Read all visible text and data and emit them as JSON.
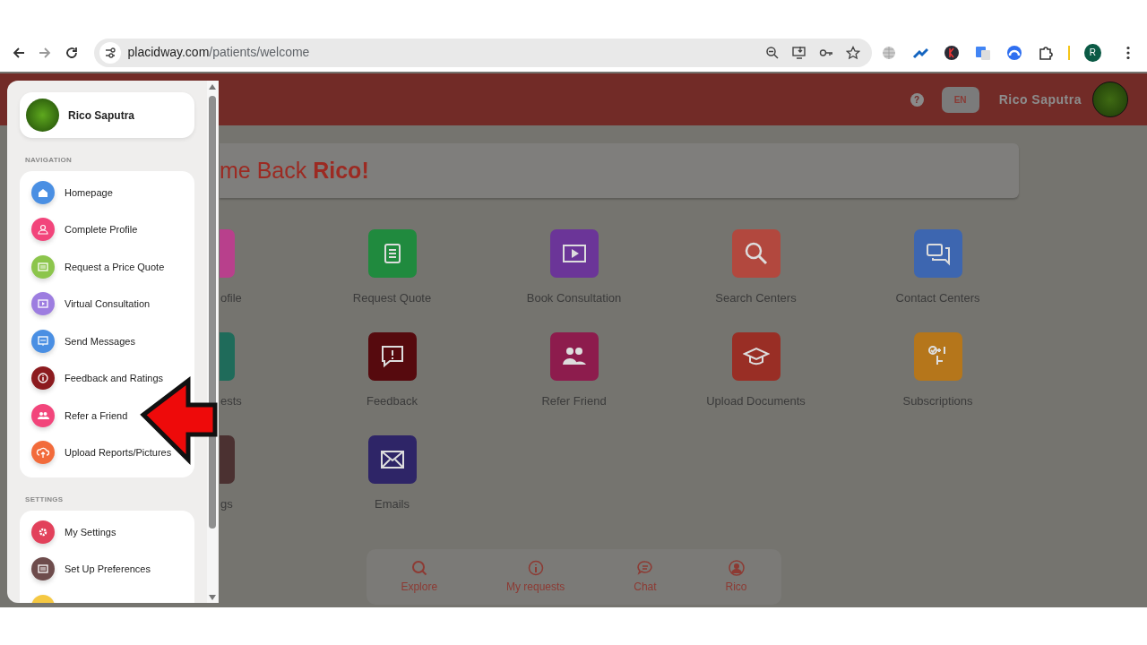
{
  "browser": {
    "url_host": "placidway.com",
    "url_path": "/patients/welcome",
    "profile_initial": "R"
  },
  "header": {
    "help": "?",
    "language": "EN",
    "user_name": "Rico Saputra"
  },
  "welcome": {
    "text": "me Back **Rico!**"
  },
  "tiles": [
    {
      "label": "ofile",
      "kind": "clipped",
      "color": "#b8408c"
    },
    {
      "label": "Request Quote",
      "kind": "full",
      "color": "#208a3e"
    },
    {
      "label": "Book Consultation",
      "kind": "full",
      "color": "#6b3598"
    },
    {
      "label": "Search Centers",
      "kind": "full",
      "color": "#b2483e"
    },
    {
      "label": "Contact Centers",
      "kind": "full",
      "color": "#3d66b0"
    },
    {
      "label": "ests",
      "kind": "clipped",
      "color": "#1f6b5a"
    },
    {
      "label": "Feedback",
      "kind": "full",
      "color": "#560a0e"
    },
    {
      "label": "Refer Friend",
      "kind": "full",
      "color": "#8d1c4d"
    },
    {
      "label": "Upload Documents",
      "kind": "full",
      "color": "#992e25"
    },
    {
      "label": "Subscriptions",
      "kind": "full",
      "color": "#b5761b"
    },
    {
      "label": "gs",
      "kind": "clipped",
      "color": "#4b3131"
    },
    {
      "label": "Emails",
      "kind": "full",
      "color": "#2e2567"
    }
  ],
  "bottom_nav": [
    {
      "label": "Explore"
    },
    {
      "label": "My requests"
    },
    {
      "label": "Chat"
    },
    {
      "label": "Rico"
    }
  ],
  "drawer": {
    "user_name": "Rico Saputra",
    "sections": [
      {
        "title": "NAVIGATION",
        "items": [
          {
            "label": "Homepage",
            "color": "#4a8fe3"
          },
          {
            "label": "Complete Profile",
            "color": "#f2457b"
          },
          {
            "label": "Request a Price Quote",
            "color": "#8cc54c"
          },
          {
            "label": "Virtual Consultation",
            "color": "#9d7de0"
          },
          {
            "label": "Send Messages",
            "color": "#4a8fe3"
          },
          {
            "label": "Feedback and Ratings",
            "color": "#8c1b1f"
          },
          {
            "label": "Refer a Friend",
            "color": "#f2457b"
          },
          {
            "label": "Upload Reports/Pictures",
            "color": "#f26b3b"
          }
        ]
      },
      {
        "title": "SETTINGS",
        "items": [
          {
            "label": "My Settings",
            "color": "#e2415b"
          },
          {
            "label": "Set Up Preferences",
            "color": "#6e4c4c"
          },
          {
            "color": "#f5c842"
          }
        ]
      }
    ]
  }
}
